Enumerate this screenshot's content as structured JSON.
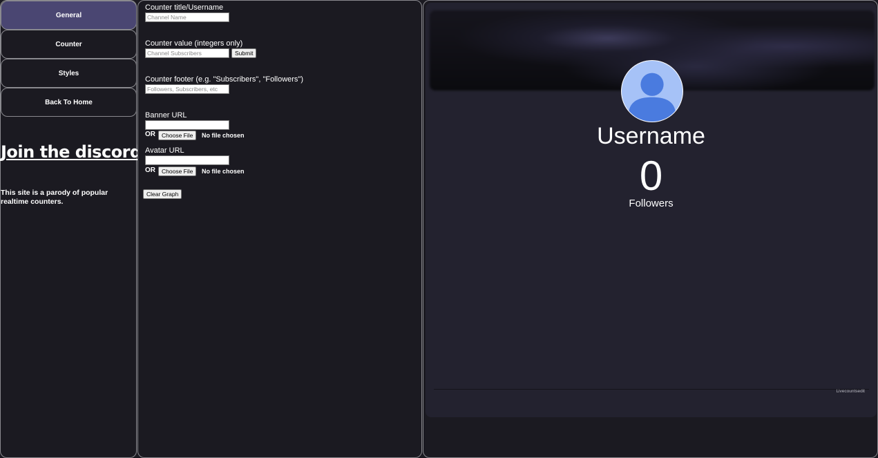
{
  "sidebar": {
    "items": [
      {
        "label": "General"
      },
      {
        "label": "Counter"
      },
      {
        "label": "Styles"
      },
      {
        "label": "Back To Home"
      }
    ],
    "discord_link": "Join the discord.",
    "disclaimer": "This site is a parody of popular realtime counters."
  },
  "settings": {
    "title": {
      "label": "Counter title/Username",
      "placeholder": "Channel Name"
    },
    "value": {
      "label": "Counter value (integers only)",
      "placeholder": "Channel Subscribers",
      "submit_label": "Submit"
    },
    "footer": {
      "label": "Counter footer (e.g. \"Subscribers\", \"Followers\")",
      "placeholder": "Followers, Subscribers, etc"
    },
    "banner": {
      "label": "Banner URL",
      "or_label": "OR",
      "choose_label": "Choose File",
      "no_file": "No file chosen"
    },
    "avatar": {
      "label": "Avatar URL",
      "or_label": "OR",
      "choose_label": "Choose File",
      "no_file": "No file chosen"
    },
    "clear_graph_label": "Clear Graph"
  },
  "preview": {
    "username": "Username",
    "count": "0",
    "footer": "Followers",
    "watermark": "Livecountsedit"
  },
  "colors": {
    "background": "#1b1a21",
    "active_nav": "#4a4672",
    "card": "#23222f",
    "avatar_bg": "#a6c2f7",
    "avatar_figure": "#4a7bdf"
  },
  "icons": {
    "avatar": "default-user-icon"
  }
}
